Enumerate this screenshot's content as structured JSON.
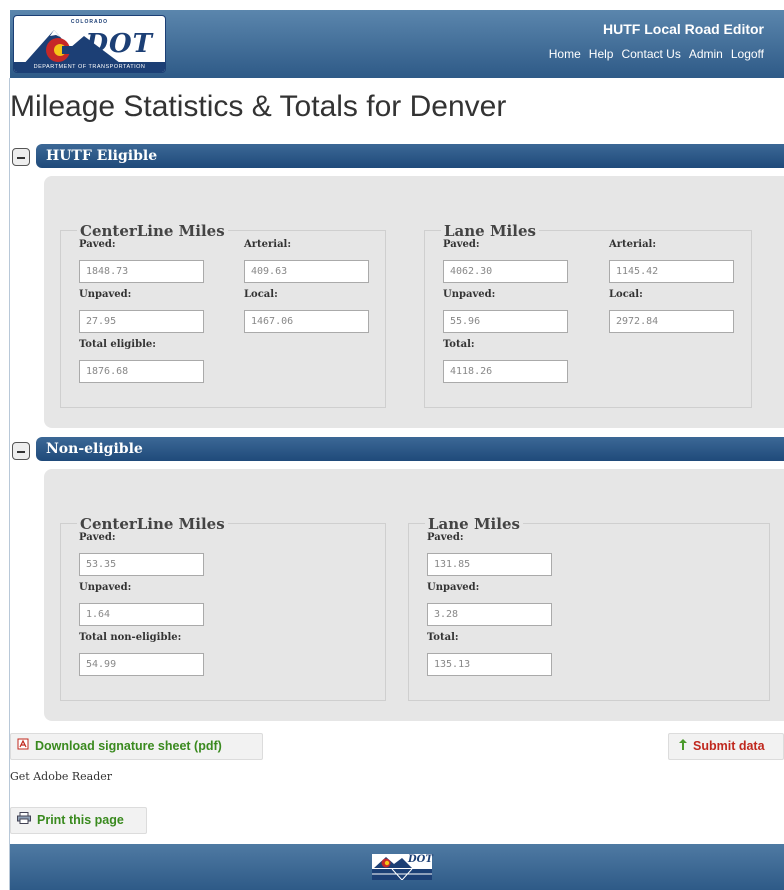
{
  "header": {
    "app_title": "HUTF Local Road Editor",
    "logo": {
      "top_text": "COLORADO",
      "main_text": "DOT",
      "bottom_text": "DEPARTMENT OF TRANSPORTATION"
    },
    "nav": [
      {
        "id": "home",
        "label": "Home"
      },
      {
        "id": "help",
        "label": "Help"
      },
      {
        "id": "contact",
        "label": "Contact Us"
      },
      {
        "id": "admin",
        "label": "Admin"
      },
      {
        "id": "logoff",
        "label": "Logoff"
      }
    ]
  },
  "page_title": "Mileage Statistics & Totals for Denver",
  "eligible": {
    "title": "HUTF Eligible",
    "centerline": {
      "legend": "CenterLine Miles",
      "paved_label": "Paved:",
      "paved": "1848.73",
      "arterial_label": "Arterial:",
      "arterial": "409.63",
      "unpaved_label": "Unpaved:",
      "unpaved": "27.95",
      "local_label": "Local:",
      "local": "1467.06",
      "total_label": "Total eligible:",
      "total": "1876.68"
    },
    "lane": {
      "legend": "Lane Miles",
      "paved_label": "Paved:",
      "paved": "4062.30",
      "arterial_label": "Arterial:",
      "arterial": "1145.42",
      "unpaved_label": "Unpaved:",
      "unpaved": "55.96",
      "local_label": "Local:",
      "local": "2972.84",
      "total_label": "Total:",
      "total": "4118.26"
    }
  },
  "noneligible": {
    "title": "Non-eligible",
    "centerline": {
      "legend": "CenterLine Miles",
      "paved_label": "Paved:",
      "paved": "53.35",
      "unpaved_label": "Unpaved:",
      "unpaved": "1.64",
      "total_label": "Total non-eligible:",
      "total": "54.99"
    },
    "lane": {
      "legend": "Lane Miles",
      "paved_label": "Paved:",
      "paved": "131.85",
      "unpaved_label": "Unpaved:",
      "unpaved": "3.28",
      "total_label": "Total:",
      "total": "135.13"
    }
  },
  "actions": {
    "download_label": "Download signature sheet (pdf)",
    "submit_label": "Submit data",
    "adobe_text": "Get Adobe Reader",
    "print_label": "Print this page"
  },
  "footer": {
    "logo_text": "DOT"
  },
  "colors": {
    "header_blue": "#2e5a87",
    "section_blue": "#1f4a7a",
    "panel_gray": "#e6e6e6",
    "download_green": "#3a8a1f",
    "submit_red": "#c0281e",
    "pdf_icon_red": "#c0281e"
  },
  "icons": {
    "toggle": "collapse-minus-icon",
    "download": "pdf-icon",
    "submit": "arrow-up-icon",
    "print": "printer-icon"
  }
}
